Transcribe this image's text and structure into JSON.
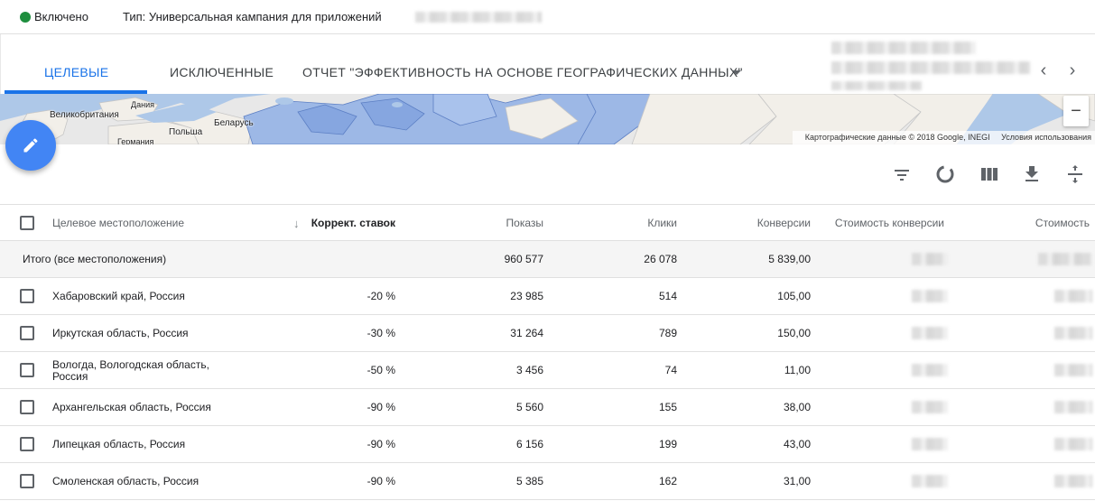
{
  "status": {
    "label": "Включено",
    "color": "#1e8e3e",
    "type_text": "Тип: Универсальная кампания для приложений"
  },
  "tabs": [
    {
      "label": "ЦЕЛЕВЫЕ",
      "active": true
    },
    {
      "label": "ИСКЛЮЧЕННЫЕ",
      "active": false
    },
    {
      "label": "ОТЧЕТ \"ЭФФЕКТИВНОСТЬ НА ОСНОВЕ ГЕОГРАФИЧЕСКИХ ДАННЫХ\"",
      "active": false
    }
  ],
  "nav": {
    "prev_icon": "chevron-left-icon",
    "next_icon": "chevron-right-icon"
  },
  "map": {
    "labels": {
      "uk": "Великобритания",
      "denmark": "Дания",
      "belarus": "Беларусь",
      "poland": "Польша",
      "germany": "Германия"
    },
    "attribution": "Картографические данные © 2018 Google, INEGI",
    "terms": "Условия использования",
    "zoom_out": "−"
  },
  "toolbar": {
    "icons": [
      "filter-icon",
      "segment-icon",
      "columns-icon",
      "download-icon",
      "expand-icon"
    ]
  },
  "table": {
    "headers": {
      "location": "Целевое местоположение",
      "bid_adj": "Коррект. ставок",
      "impressions": "Показы",
      "clicks": "Клики",
      "conversions": "Конверсии",
      "conv_cost": "Стоимость конверсии",
      "cost": "Стоимость"
    },
    "total": {
      "label": "Итого (все местоположения)",
      "impressions": "960 577",
      "clicks": "26 078",
      "conversions": "5 839,00"
    },
    "rows": [
      {
        "location": "Хабаровский край, Россия",
        "bid_adj": "-20 %",
        "impressions": "23 985",
        "clicks": "514",
        "conversions": "105,00"
      },
      {
        "location": "Иркутская область, Россия",
        "bid_adj": "-30 %",
        "impressions": "31 264",
        "clicks": "789",
        "conversions": "150,00"
      },
      {
        "location": "Вологда, Вологодская область, Россия",
        "bid_adj": "-50 %",
        "impressions": "3 456",
        "clicks": "74",
        "conversions": "11,00"
      },
      {
        "location": "Архангельская область, Россия",
        "bid_adj": "-90 %",
        "impressions": "5 560",
        "clicks": "155",
        "conversions": "38,00"
      },
      {
        "location": "Липецкая область, Россия",
        "bid_adj": "-90 %",
        "impressions": "6 156",
        "clicks": "199",
        "conversions": "43,00"
      },
      {
        "location": "Смоленская область, Россия",
        "bid_adj": "-90 %",
        "impressions": "5 385",
        "clicks": "162",
        "conversions": "31,00"
      }
    ]
  }
}
